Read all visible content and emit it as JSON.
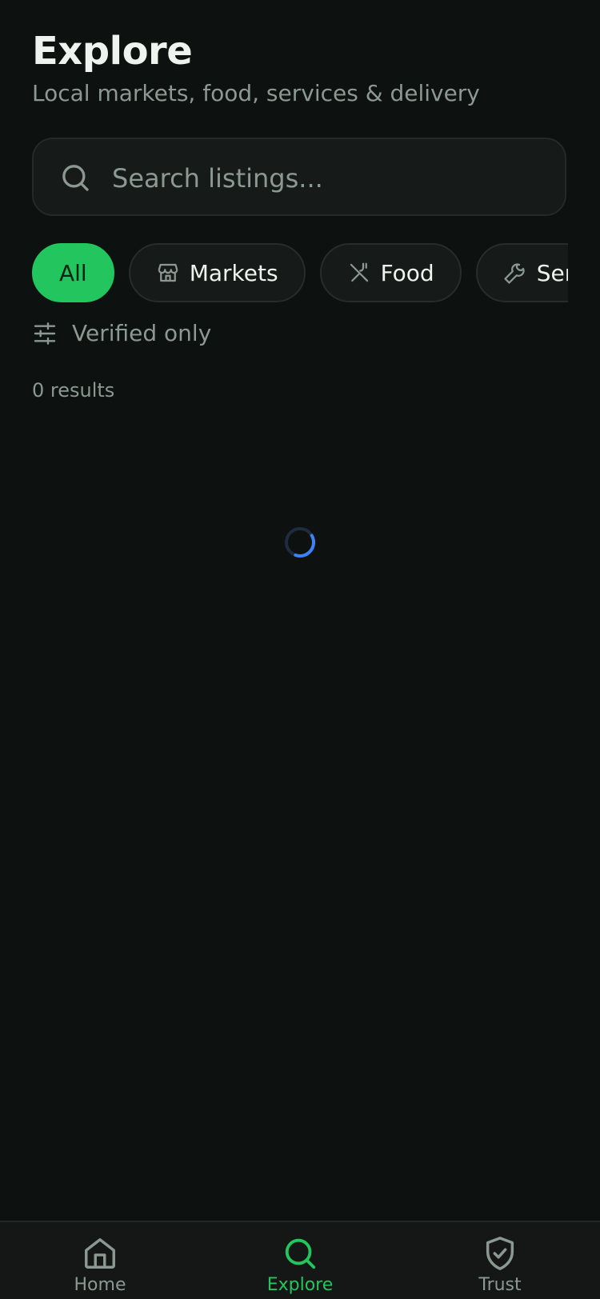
{
  "header": {
    "title": "Explore",
    "subtitle": "Local markets, food, services & delivery"
  },
  "search": {
    "placeholder": "Search listings...",
    "value": "",
    "icon": "search-icon"
  },
  "chips": [
    {
      "label": "All",
      "icon": null,
      "active": true
    },
    {
      "label": "Markets",
      "icon": "store-icon",
      "active": false
    },
    {
      "label": "Food",
      "icon": "utensils-off-icon",
      "active": false
    },
    {
      "label": "Services",
      "icon": "wrench-icon",
      "active": false
    }
  ],
  "filter": {
    "label": "Verified only",
    "icon": "sliders-icon"
  },
  "results": {
    "label": "0 results"
  },
  "tabbar": {
    "home": {
      "label": "Home",
      "icon": "home-icon"
    },
    "explore": {
      "label": "Explore",
      "icon": "search-icon",
      "active": true
    },
    "trust": {
      "label": "Trust",
      "icon": "shield-check-icon"
    }
  },
  "colors": {
    "background": "#0d1110",
    "accent": "#22c55e",
    "spinner": "#3b82f6"
  }
}
